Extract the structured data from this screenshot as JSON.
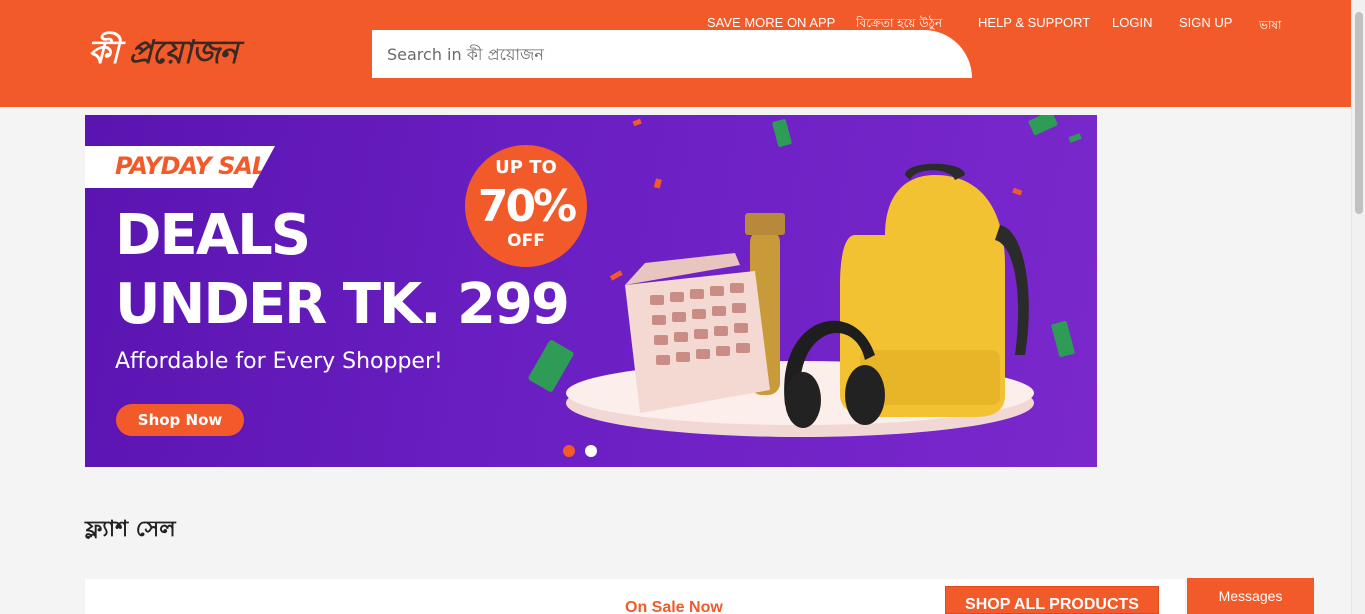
{
  "header": {
    "logo_text_light": "কী ",
    "logo_text_dark": "প্রয়োজন",
    "search_placeholder": "Search in কী প্রয়োজন",
    "nav": [
      {
        "label": "SAVE MORE ON APP"
      },
      {
        "label": "বিক্রেতা হয়ে উঠুন"
      },
      {
        "label": "HELP & SUPPORT"
      },
      {
        "label": "LOGIN"
      },
      {
        "label": "SIGN UP"
      },
      {
        "label": "ভাষা"
      }
    ]
  },
  "banner": {
    "sale_tag": "PAYDAY SALE",
    "headline_line1": "DEALS",
    "headline_line2": "UNDER TK. 299",
    "tagline": "Affordable for Every Shopper!",
    "cta_label": "Shop Now",
    "badge_top": "UP TO",
    "badge_value": "70%",
    "badge_bottom": "OFF",
    "active_slide": 1,
    "slide_count": 2
  },
  "flash_sale": {
    "title": "ফ্ল্যাশ সেল",
    "on_sale_label": "On Sale Now",
    "shop_all_label": "SHOP ALL PRODUCTS"
  },
  "chat": {
    "label": "Messages"
  },
  "colors": {
    "brand": "#f25a2a",
    "banner_purple": "#6a1fc2",
    "background": "#f4f4f4"
  }
}
